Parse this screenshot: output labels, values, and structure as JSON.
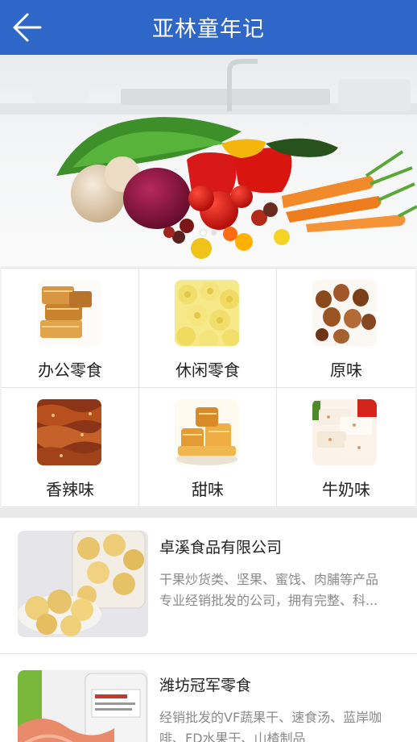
{
  "header": {
    "title": "亚林童年记",
    "back_icon": "back-arrow-icon",
    "background": "#2f67c8"
  },
  "banner": {
    "slide_count": 2,
    "active_slide": 1
  },
  "categories": [
    {
      "label": "办公零食",
      "icon": "office-snacks-thumb"
    },
    {
      "label": "休闲零食",
      "icon": "leisure-snacks-thumb"
    },
    {
      "label": "原味",
      "icon": "original-flavor-thumb"
    },
    {
      "label": "香辣味",
      "icon": "spicy-flavor-thumb"
    },
    {
      "label": "甜味",
      "icon": "sweet-flavor-thumb"
    },
    {
      "label": "牛奶味",
      "icon": "milk-flavor-thumb"
    }
  ],
  "stores": [
    {
      "name": "卓溪食品有限公司",
      "desc_line1": "干果炒货类、坚果、蜜饯、肉脯等产品",
      "desc_line2": "专业经销批发的公司，拥有完整、科..."
    },
    {
      "name": "潍坊冠军零食",
      "desc_line1": "经销批发的VF蔬果干、速食汤、蓝岸咖",
      "desc_line2": "啡、FD水果干、山楂制品"
    }
  ]
}
